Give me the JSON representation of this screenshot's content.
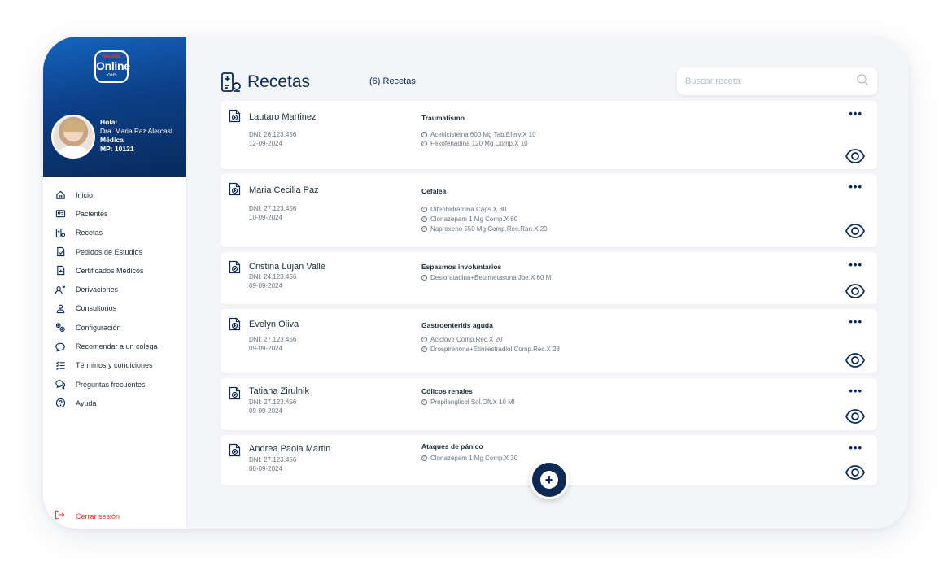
{
  "brand": {
    "logo_top": "Recetas",
    "logo_main": "Online",
    "logo_sub": ".com"
  },
  "user": {
    "greeting": "Hola!",
    "name": "Dra. Maria Paz Alercast",
    "role": "Médica",
    "license": "MP: 10121"
  },
  "nav": [
    {
      "label": "Inicio",
      "icon": "home-icon"
    },
    {
      "label": "Pacientes",
      "icon": "id-card-icon"
    },
    {
      "label": "Recetas",
      "icon": "prescription-icon"
    },
    {
      "label": "Pedidos de Estudios",
      "icon": "study-order-icon"
    },
    {
      "label": "Certificados Médicos",
      "icon": "certificate-icon"
    },
    {
      "label": "Derivaciones",
      "icon": "referral-icon"
    },
    {
      "label": "Consultorios",
      "icon": "office-icon"
    },
    {
      "label": "Configuración",
      "icon": "settings-icon"
    },
    {
      "label": "Recomendar a un colega",
      "icon": "recommend-icon"
    },
    {
      "label": "Términos y condiciones",
      "icon": "terms-icon"
    },
    {
      "label": "Preguntas frecuentes",
      "icon": "faq-icon"
    },
    {
      "label": "Ayuda",
      "icon": "help-icon"
    }
  ],
  "logout_label": "Cerrar sesión",
  "page": {
    "title": "Recetas",
    "count": "(6) Recetas"
  },
  "search": {
    "placeholder": "Buscar receta"
  },
  "recipes": [
    {
      "name": "Lautaro Martinez",
      "dni": "DNI: 26.123.456",
      "date": "12-09-2024",
      "diagnosis": "Traumatismo",
      "meds": [
        "Acetilcisteina 600 Mg Tab.Eferv.X 10",
        "Fexofenadina 120 Mg Comp.X 10"
      ]
    },
    {
      "name": "Maria Cecilia Paz",
      "dni": "DNI: 27.123.456",
      "date": "10-09-2024",
      "diagnosis": "Cefalea",
      "meds": [
        "Difenhidramina Cáps.X 30",
        "Clonazepam 1 Mg Comp.X 60",
        "Naproxeno 550 Mg Comp.Rec.Ran.X 20"
      ]
    },
    {
      "name": "Cristina Lujan Valle",
      "dni": "DNI: 24.123.456",
      "date": "09-09-2024",
      "diagnosis": "Espasmos involuntarios",
      "meds": [
        "Desloratadina+Betametasona Jbe.X 60 Ml"
      ]
    },
    {
      "name": "Evelyn Oliva",
      "dni": "DNI: 27.123.456",
      "date": "09-09-2024",
      "diagnosis": "Gastroenteritis aguda",
      "meds": [
        "Aciclovir Comp.Rec.X 20",
        "Drospirenona+Etinilestradiol Comp.Rec.X 28"
      ]
    },
    {
      "name": "Tatiana Zirulnik",
      "dni": "DNI: 27.123.456",
      "date": "09-09-2024",
      "diagnosis": "Cólicos renales",
      "meds": [
        "Propilenglicol Sol.Oft.X 10 Ml"
      ]
    },
    {
      "name": "Andrea Paola Martin",
      "dni": "DNI: 27.123.456",
      "date": "08-09-2024",
      "diagnosis": "Ataques de pánico",
      "meds": [
        "Clonazepam 1 Mg Comp.X 30"
      ]
    }
  ],
  "colors": {
    "navy": "#0d2a55",
    "accent_red": "#e53935",
    "sidebar_top": "#0c3f86"
  }
}
